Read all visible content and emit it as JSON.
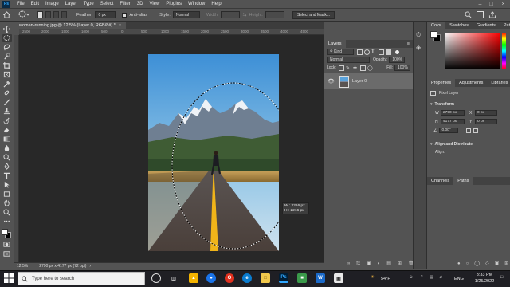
{
  "app": {
    "logo": "Ps",
    "menu": [
      "File",
      "Edit",
      "Image",
      "Layer",
      "Type",
      "Select",
      "Filter",
      "3D",
      "View",
      "Plugins",
      "Window",
      "Help"
    ]
  },
  "options_bar": {
    "feather_label": "Feather:",
    "feather_value": "0 px",
    "anti_alias_label": "Anti-alias",
    "style_label": "Style:",
    "style_value": "Normal",
    "width_label": "Width:",
    "height_label": "Height:",
    "select_mask_label": "Select and Mask..."
  },
  "document": {
    "tab_title": "woman-running.jpg @ 12.5% (Layer 0, RGB/8#) *",
    "ruler_ticks": [
      "2500",
      "2000",
      "1500",
      "1000",
      "500",
      "0",
      "500",
      "1000",
      "1500",
      "2000",
      "2500",
      "3000",
      "3500",
      "4000",
      "4500",
      "5000"
    ],
    "size_tip": {
      "w_label": "W :",
      "w_value": "2216 px",
      "h_label": "H :",
      "h_value": "2216 px"
    }
  },
  "status_bar": {
    "zoom": "12.5%",
    "doc_info": "2790 px x 4177 px (72 ppi)"
  },
  "layers_panel": {
    "tabs": [
      "Layers"
    ],
    "kind_filter": "Kind",
    "blend_mode": "Normal",
    "opacity_label": "Opacity:",
    "opacity_value": "100%",
    "lock_label": "Lock:",
    "fill_label": "Fill:",
    "fill_value": "100%",
    "layers": [
      {
        "name": "Layer 0",
        "visible": true
      }
    ]
  },
  "color_panel": {
    "tabs": [
      "Color",
      "Swatches",
      "Gradients",
      "Patterns"
    ],
    "fg_color": "#ffffff",
    "bg_color": "#000000",
    "picker_hue": "#ff0000"
  },
  "properties_panel": {
    "tabs": [
      "Properties",
      "Adjustments",
      "Libraries"
    ],
    "layer_type": "Pixel Layer",
    "transform_label": "Transform",
    "w_label": "W",
    "w_value": "2790 px",
    "h_label": "H",
    "h_value": "4177 px",
    "x_label": "X",
    "x_value": "0 px",
    "y_label": "Y",
    "y_value": "0 px",
    "angle_value": "0.00°",
    "align_label": "Align and Distribute",
    "align_sub": "Align:"
  },
  "bottom_tabs": [
    "Channels",
    "Paths"
  ],
  "taskbar": {
    "search_placeholder": "Type here to search",
    "weather": "54°F",
    "lang": "ENG",
    "time": "3:33 PM",
    "date": "1/25/2022"
  }
}
